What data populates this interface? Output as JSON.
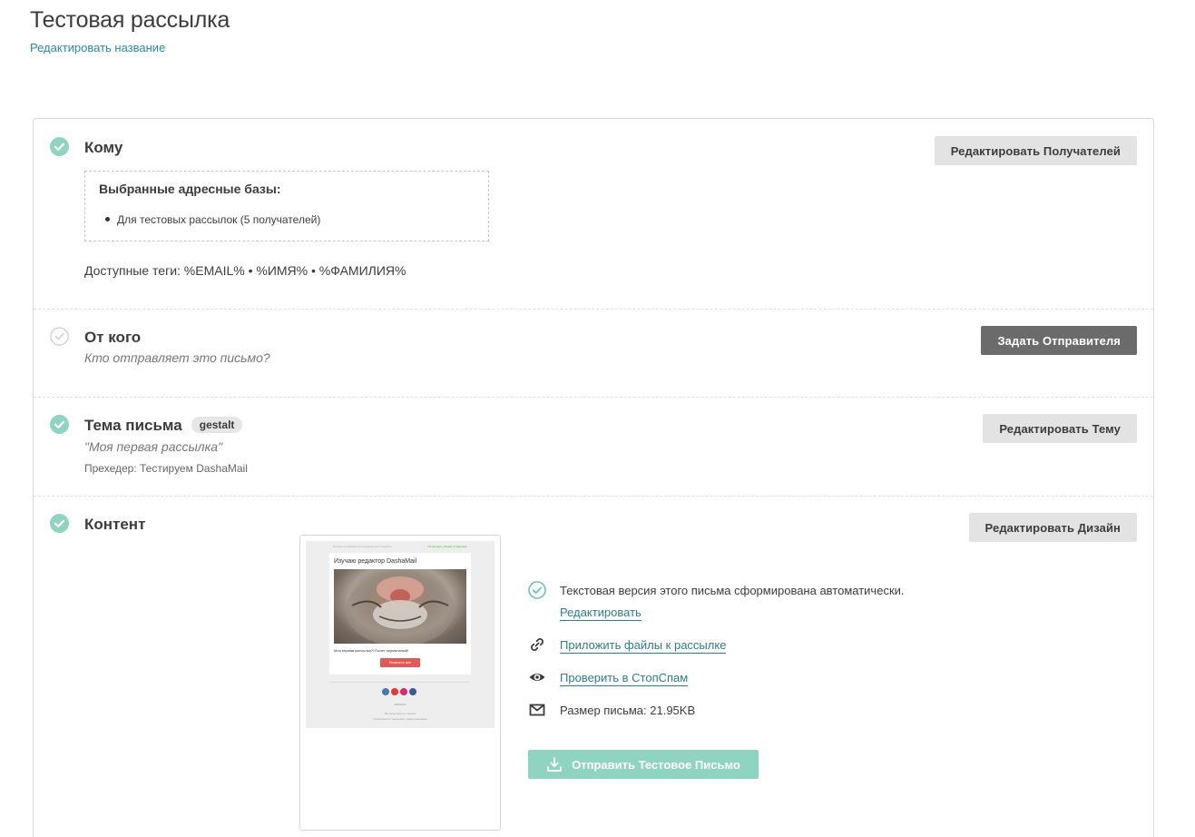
{
  "header": {
    "title": "Тестовая рассылка",
    "rename_link": "Редактировать название"
  },
  "sections": {
    "recipients": {
      "title": "Кому",
      "button": "Редактировать Получателей",
      "bases_title": "Выбранные адресные базы:",
      "bases_items": [
        "Для тестовых рассылок (5 получателей)"
      ],
      "tags": "Доступные теги: %EMAIL% • %ИМЯ% • %ФАМИЛИЯ%"
    },
    "sender": {
      "title": "От кого",
      "subtitle": "Кто отправляет это письмо?",
      "button": "Задать Отправителя"
    },
    "subject": {
      "title": "Тема письма",
      "badge": "gestalt",
      "subject_text": "\"Моя первая рассылка\"",
      "preheader": "Прехедер: Тестируем DashaMail",
      "button": "Редактировать Тему"
    },
    "content": {
      "title": "Контент",
      "button": "Редактировать Дизайн",
      "preview": {
        "top_text": "Письмо отображается некорректно? Откройте",
        "top_link": "Посмотреть письмо в браузере",
        "heading": "Изучаю редактор DashaMail",
        "body_text": "Моя первая рассылка?! Полет нормальный!",
        "button": "Позвонить мне",
        "footer_line1": "#0000000",
        "footer_line2": "Вы получили это письмо",
        "footer_line3": "Отписаться от рассылки | Адрес компании"
      },
      "text_version": "Текстовая версия этого письма сформирована автоматически.",
      "edit_link": "Редактировать",
      "attach_link": "Приложить файлы к рассылке",
      "stopspam_link": "Проверить в СтопСпам",
      "size": "Размер письма: 21.95KB",
      "send_button": "Отправить Тестовое Письмо"
    }
  },
  "colors": {
    "check_done": "#8fd3c1",
    "check_pending": "#cccccc",
    "link": "#2e8aa0",
    "send_button": "#8fd3c1"
  }
}
